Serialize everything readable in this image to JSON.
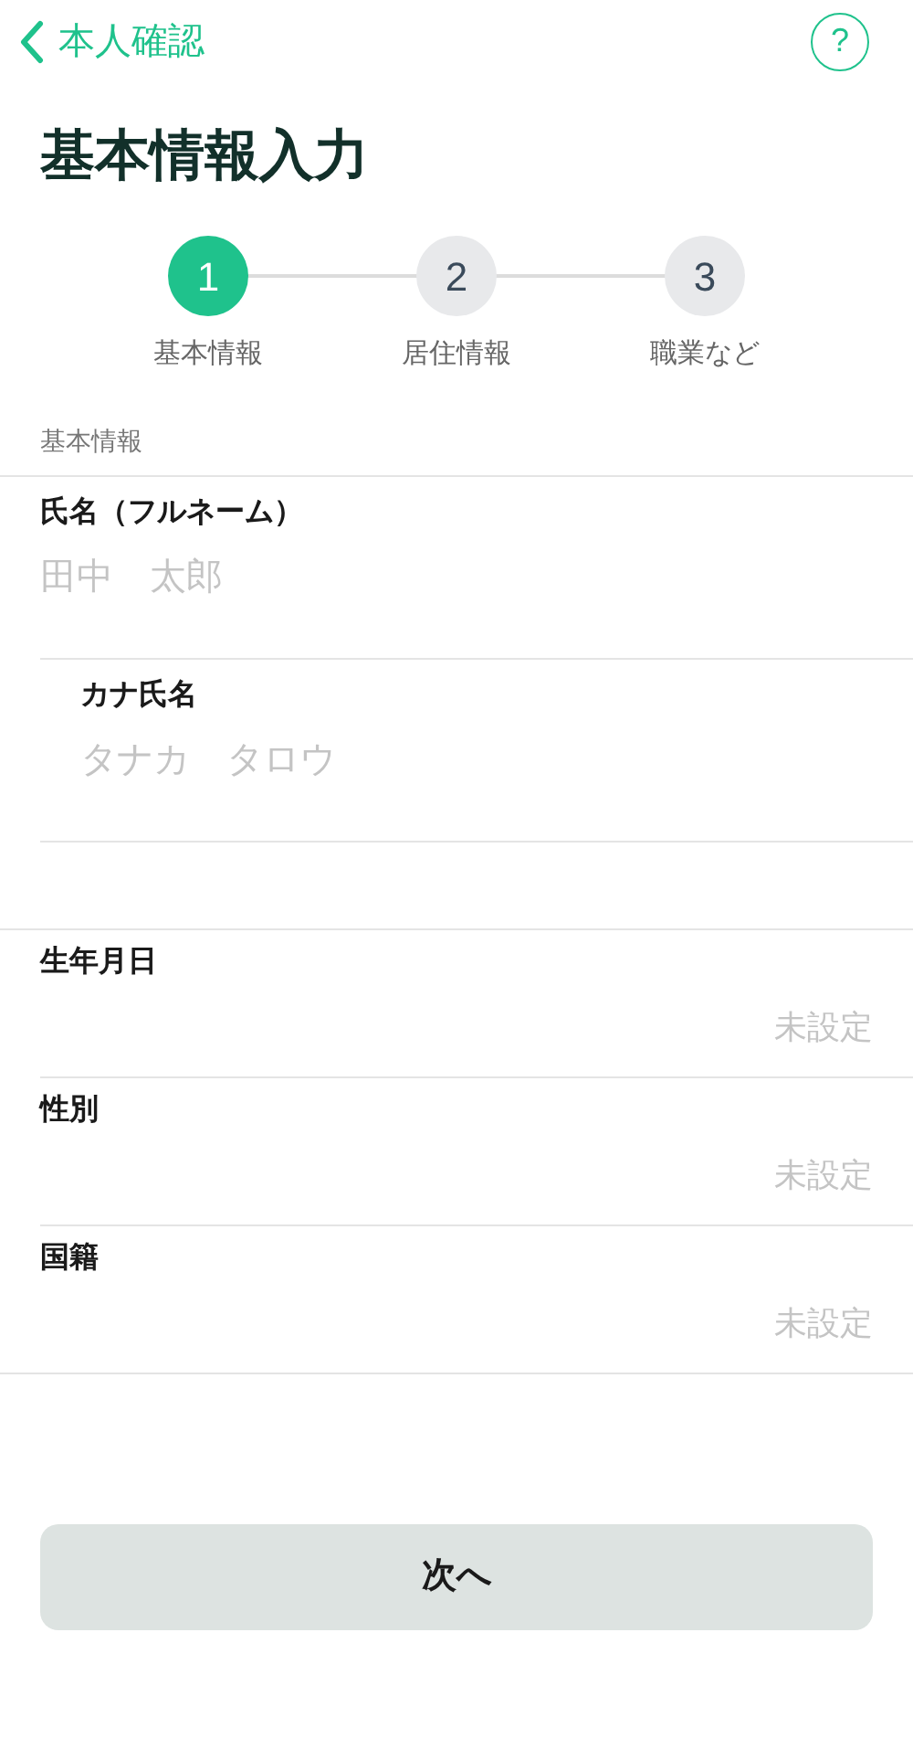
{
  "nav": {
    "back_label": "本人確認",
    "help_label": "?"
  },
  "title": "基本情報入力",
  "steps": [
    {
      "number": "1",
      "label": "基本情報",
      "selected": true
    },
    {
      "number": "2",
      "label": "居住情報",
      "selected": false
    },
    {
      "number": "3",
      "label": "職業など",
      "selected": false
    }
  ],
  "section_label": "基本情報",
  "text_fields": [
    {
      "label": "氏名（フルネーム）",
      "placeholder": "田中　太郎"
    },
    {
      "label": "カナ氏名",
      "placeholder": "タナカ　タロウ"
    }
  ],
  "select_rows": [
    {
      "label": "生年月日",
      "value": "未設定"
    },
    {
      "label": "性別",
      "value": "未設定"
    },
    {
      "label": "国籍",
      "value": "未設定"
    }
  ],
  "next_button": "次へ"
}
